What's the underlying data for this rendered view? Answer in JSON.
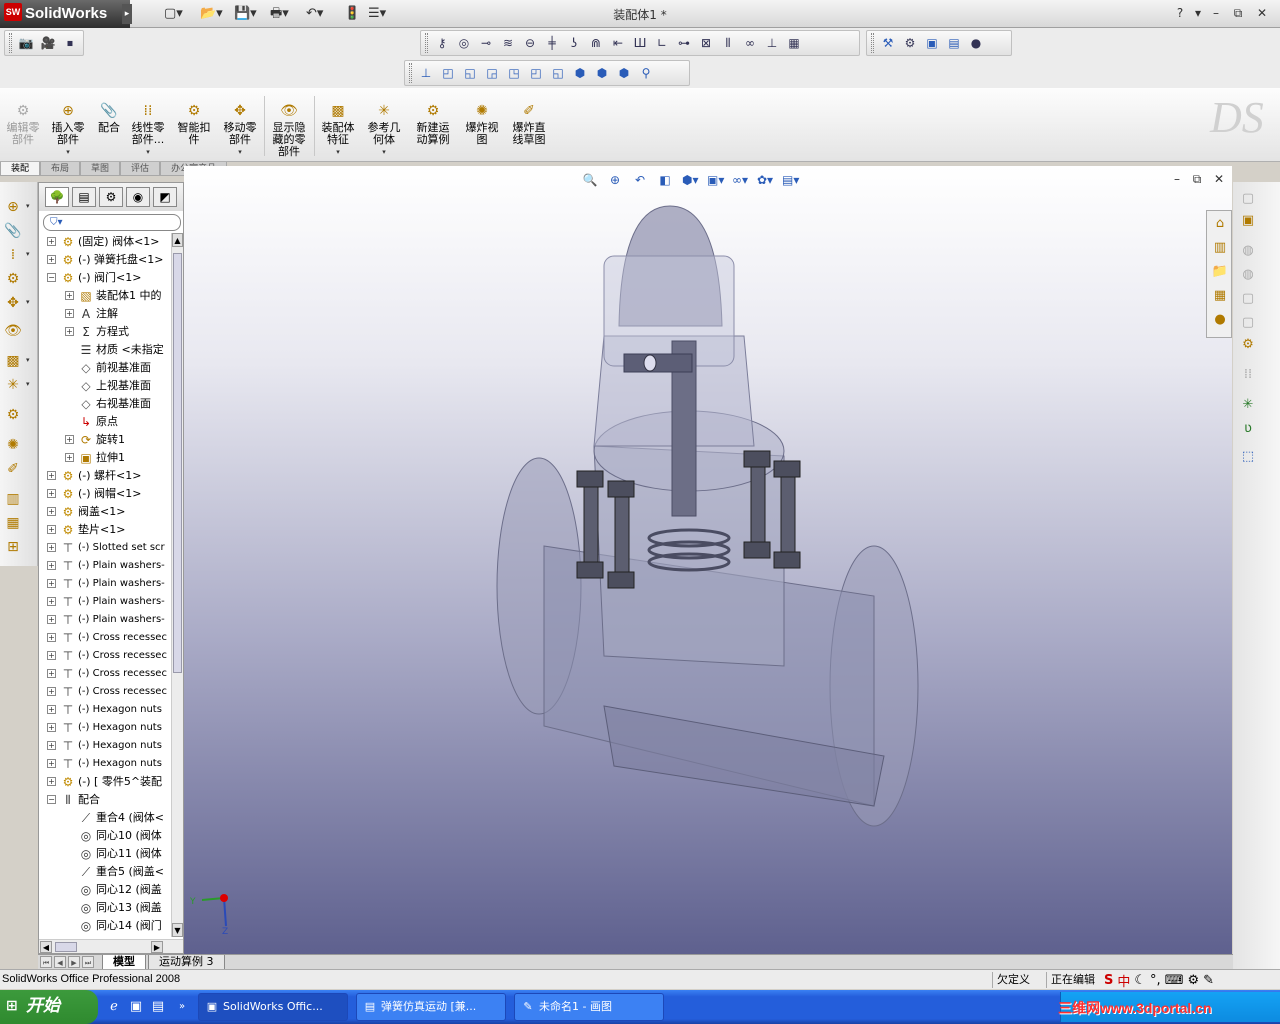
{
  "app": {
    "logo": "SolidWorks",
    "title": "装配体1 *",
    "window_controls": [
      "?",
      "▾",
      "–",
      "⧉",
      "✕"
    ]
  },
  "quick_access": [
    "new-icon",
    "open-icon",
    "save-icon",
    "print-icon",
    "undo-icon",
    "rebuild-icon",
    "options-icon"
  ],
  "command_manager": {
    "items": [
      {
        "label": "编辑零\n部件",
        "icon": "edit-component-icon",
        "disabled": true
      },
      {
        "label": "插入零\n部件",
        "icon": "insert-component-icon",
        "has_dropdown": true
      },
      {
        "label": "配合",
        "icon": "mate-icon"
      },
      {
        "label": "线性零\n部件...",
        "icon": "linear-pattern-icon",
        "has_dropdown": true
      },
      {
        "label": "智能扣\n件",
        "icon": "smart-fastener-icon"
      },
      {
        "label": "移动零\n部件",
        "icon": "move-component-icon",
        "has_dropdown": true
      },
      {
        "label": "显示隐\n藏的零\n部件",
        "icon": "show-hidden-icon"
      },
      {
        "label": "装配体\n特征",
        "icon": "assembly-feature-icon",
        "has_dropdown": true
      },
      {
        "label": "参考几\n何体",
        "icon": "reference-geometry-icon",
        "has_dropdown": true
      },
      {
        "label": "新建运\n动算例",
        "icon": "new-motion-study-icon"
      },
      {
        "label": "爆炸视\n图",
        "icon": "exploded-view-icon"
      },
      {
        "label": "爆炸直\n线草图",
        "icon": "explode-line-sketch-icon"
      }
    ],
    "tabs": [
      "装配",
      "布局",
      "草图",
      "评估",
      "办公室产品"
    ],
    "active_tab": 0
  },
  "feature_manager": {
    "tree": [
      {
        "label": "(固定) 阀体<1>",
        "icon": "part-icon",
        "depth": 0,
        "expand": "+"
      },
      {
        "label": "(-) 弹簧托盘<1>",
        "icon": "part-icon",
        "depth": 0,
        "expand": "+"
      },
      {
        "label": "(-) 阀门<1>",
        "icon": "part-icon",
        "depth": 0,
        "expand": "-"
      },
      {
        "label": "装配体1 中的",
        "icon": "folder-icon",
        "depth": 1,
        "expand": "+"
      },
      {
        "label": "注解",
        "icon": "annotation-icon",
        "depth": 1,
        "expand": "+"
      },
      {
        "label": "方程式",
        "icon": "equation-icon",
        "depth": 1,
        "expand": "+"
      },
      {
        "label": "材质 <未指定",
        "icon": "material-icon",
        "depth": 1,
        "expand": ""
      },
      {
        "label": "前视基准面",
        "icon": "plane-icon",
        "depth": 1,
        "expand": ""
      },
      {
        "label": "上视基准面",
        "icon": "plane-icon",
        "depth": 1,
        "expand": ""
      },
      {
        "label": "右视基准面",
        "icon": "plane-icon",
        "depth": 1,
        "expand": ""
      },
      {
        "label": "原点",
        "icon": "origin-icon",
        "depth": 1,
        "expand": ""
      },
      {
        "label": "旋转1",
        "icon": "revolve-icon",
        "depth": 1,
        "expand": "+"
      },
      {
        "label": "拉伸1",
        "icon": "extrude-icon",
        "depth": 1,
        "expand": "+"
      },
      {
        "label": "(-) 螺杆<1>",
        "icon": "part-icon",
        "depth": 0,
        "expand": "+"
      },
      {
        "label": "(-) 阀帽<1>",
        "icon": "part-icon",
        "depth": 0,
        "expand": "+"
      },
      {
        "label": "阀盖<1>",
        "icon": "part-icon",
        "depth": 0,
        "expand": "+"
      },
      {
        "label": "垫片<1>",
        "icon": "part-icon",
        "depth": 0,
        "expand": "+"
      },
      {
        "label": "(-) Slotted set scr",
        "icon": "toolbox-part-icon",
        "depth": 0,
        "expand": "+",
        "en": true
      },
      {
        "label": "(-) Plain washers-",
        "icon": "toolbox-part-icon",
        "depth": 0,
        "expand": "+",
        "en": true
      },
      {
        "label": "(-) Plain washers-",
        "icon": "toolbox-part-icon",
        "depth": 0,
        "expand": "+",
        "en": true
      },
      {
        "label": "(-) Plain washers-",
        "icon": "toolbox-part-icon",
        "depth": 0,
        "expand": "+",
        "en": true
      },
      {
        "label": "(-) Plain washers-",
        "icon": "toolbox-part-icon",
        "depth": 0,
        "expand": "+",
        "en": true
      },
      {
        "label": "(-) Cross recessec",
        "icon": "toolbox-part-icon",
        "depth": 0,
        "expand": "+",
        "en": true
      },
      {
        "label": "(-) Cross recessec",
        "icon": "toolbox-part-icon",
        "depth": 0,
        "expand": "+",
        "en": true
      },
      {
        "label": "(-) Cross recessec",
        "icon": "toolbox-part-icon",
        "depth": 0,
        "expand": "+",
        "en": true
      },
      {
        "label": "(-) Cross recessec",
        "icon": "toolbox-part-icon",
        "depth": 0,
        "expand": "+",
        "en": true
      },
      {
        "label": "(-) Hexagon nuts",
        "icon": "toolbox-part-icon",
        "depth": 0,
        "expand": "+",
        "en": true
      },
      {
        "label": "(-) Hexagon nuts",
        "icon": "toolbox-part-icon",
        "depth": 0,
        "expand": "+",
        "en": true
      },
      {
        "label": "(-) Hexagon nuts",
        "icon": "toolbox-part-icon",
        "depth": 0,
        "expand": "+",
        "en": true
      },
      {
        "label": "(-) Hexagon nuts",
        "icon": "toolbox-part-icon",
        "depth": 0,
        "expand": "+",
        "en": true
      },
      {
        "label": "(-) [ 零件5^装配",
        "icon": "part-icon",
        "depth": 0,
        "expand": "+"
      },
      {
        "label": "配合",
        "icon": "mates-folder-icon",
        "depth": 0,
        "expand": "-"
      },
      {
        "label": "重合4 (阀体<",
        "icon": "coincident-icon",
        "depth": 1,
        "expand": ""
      },
      {
        "label": "同心10 (阀体",
        "icon": "concentric-icon",
        "depth": 1,
        "expand": ""
      },
      {
        "label": "同心11 (阀体",
        "icon": "concentric-icon",
        "depth": 1,
        "expand": ""
      },
      {
        "label": "重合5 (阀盖<",
        "icon": "coincident-icon",
        "depth": 1,
        "expand": ""
      },
      {
        "label": "同心12 (阀盖",
        "icon": "concentric-icon",
        "depth": 1,
        "expand": ""
      },
      {
        "label": "同心13 (阀盖",
        "icon": "concentric-icon",
        "depth": 1,
        "expand": ""
      },
      {
        "label": "同心14 (阀门",
        "icon": "concentric-icon",
        "depth": 1,
        "expand": ""
      }
    ]
  },
  "viewport": {
    "triad_axes": [
      "Y",
      "Z"
    ]
  },
  "bottom_tabs": [
    "模型",
    "运动算例 3"
  ],
  "status": {
    "product": "SolidWorks Office Professional 2008",
    "definition": "欠定义",
    "mode": "正在编辑"
  },
  "taskbar": {
    "start": "开始",
    "tasks": [
      "SolidWorks Offic...",
      "弹簧仿真运动 [兼...",
      "未命名1 - 画图"
    ],
    "watermark": "三维网www.3dportal.cn"
  }
}
